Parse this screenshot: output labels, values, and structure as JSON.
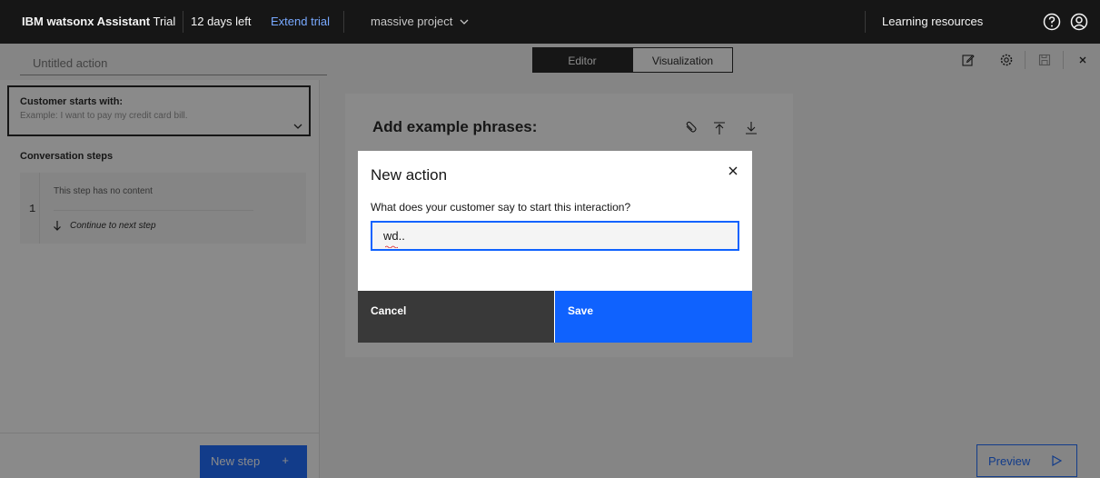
{
  "topbar": {
    "product_bold": "IBM watsonx Assistant",
    "plan": "Trial",
    "days_left": "12 days left",
    "extend": "Extend trial",
    "project": "massive project",
    "learning": "Learning resources",
    "icons": [
      "help-icon",
      "user-avatar-icon"
    ]
  },
  "toolbar": {
    "action_title_placeholder": "Untitled action",
    "tabs": [
      "Editor",
      "Visualization"
    ],
    "active_tab": "Editor",
    "icons": [
      "edit-icon",
      "settings-icon",
      "save-icon",
      "close-icon"
    ]
  },
  "left_panel": {
    "starts_label": "Customer starts with:",
    "starts_placeholder": "Example: I want to pay my credit card bill.",
    "conversation_label": "Conversation steps",
    "steps": [
      {
        "number": "1",
        "content": "This step has no content",
        "continue": "Continue to next step"
      }
    ],
    "new_step": "New step",
    "new_step_icon": "+"
  },
  "main": {
    "example_title": "Add example phrases:",
    "icons": [
      "link-icon",
      "upload-icon",
      "download-icon"
    ]
  },
  "preview": "Preview",
  "modal": {
    "title": "New action",
    "question": "What does your customer say to start this interaction?",
    "input_value": "wd..",
    "cancel": "Cancel",
    "save": "Save"
  },
  "colors": {
    "primary": "#0f62fe",
    "topbar": "#161616",
    "link": "#78a9ff"
  }
}
